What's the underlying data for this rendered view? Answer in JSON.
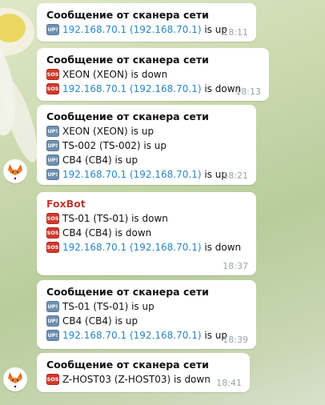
{
  "messages": [
    {
      "sender": "Сообщение от сканера сети",
      "lines": [
        {
          "icon": "up",
          "ip": "192.168.70.1",
          "paren": "(192.168.70.1)",
          "suffix": " is up"
        }
      ],
      "time": "18:11"
    },
    {
      "sender": "Сообщение от сканера сети",
      "lines": [
        {
          "icon": "sos",
          "text": "XEON (XEON) is down"
        },
        {
          "icon": "sos",
          "ip": "192.168.70.1",
          "paren": "(192.168.70.1)",
          "suffix": " is down"
        }
      ],
      "time": "18:13"
    },
    {
      "sender": "Сообщение от сканера сети",
      "lines": [
        {
          "icon": "up",
          "text": "XEON (XEON) is up"
        },
        {
          "icon": "up",
          "text": "TS-002 (TS-002) is up"
        },
        {
          "icon": "up",
          "text": "CB4 (CB4) is up"
        },
        {
          "icon": "up",
          "ip": "192.168.70.1",
          "paren": "(192.168.70.1)",
          "suffix": " is up"
        }
      ],
      "time": "18:21"
    },
    {
      "sender": "FoxBot",
      "lines": [
        {
          "icon": "sos",
          "text": "TS-01 (TS-01) is down"
        },
        {
          "icon": "sos",
          "text": "CB4 (CB4) is down"
        },
        {
          "icon": "sos",
          "ip": "192.168.70.1",
          "paren": "(192.168.70.1)",
          "suffix": " is down"
        }
      ],
      "time": "18:37"
    },
    {
      "sender": "Сообщение от сканера сети",
      "lines": [
        {
          "icon": "up",
          "text": "TS-01 (TS-01) is up"
        },
        {
          "icon": "up",
          "text": "CB4 (CB4) is up"
        },
        {
          "icon": "up",
          "ip": "192.168.70.1",
          "paren": "(192.168.70.1)",
          "suffix": " is up"
        }
      ],
      "time": "18:39"
    },
    {
      "sender": "Сообщение от сканера сети",
      "lines": [
        {
          "icon": "sos",
          "text": "Z-HOST03 (Z-HOST03) is down"
        }
      ],
      "time": "18:41"
    }
  ],
  "badges": {
    "up": "UP!",
    "sos": "SOS"
  },
  "colors": {
    "link": "#2a87c9",
    "bot_name": "#c0392b",
    "up_badge": "#6f8fae",
    "sos_badge": "#d3382d"
  }
}
